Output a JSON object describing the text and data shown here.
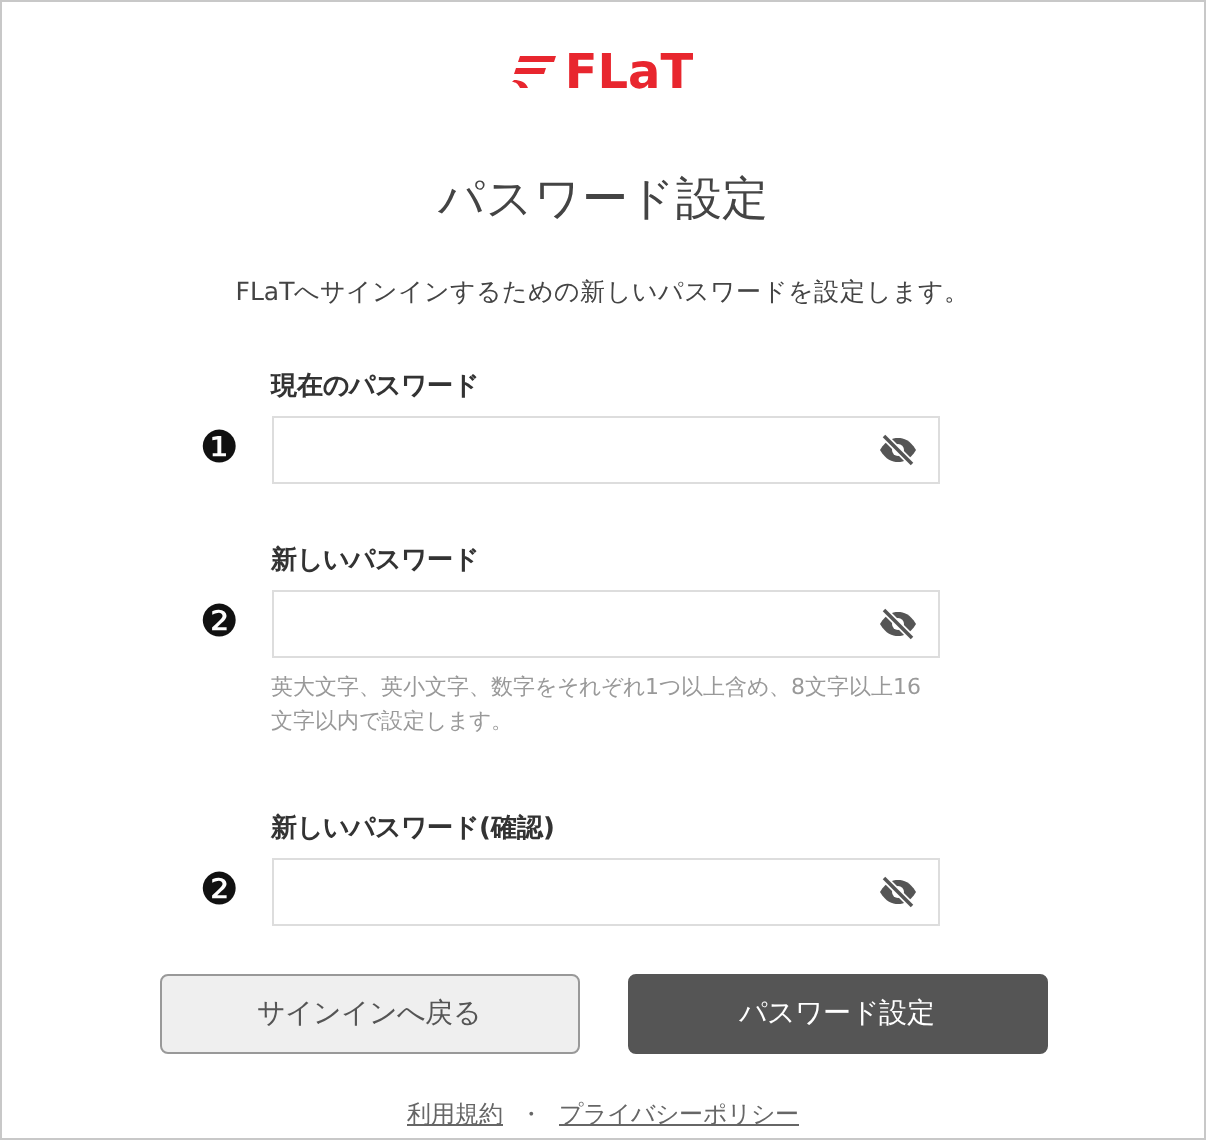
{
  "logo": {
    "text": "FLaT"
  },
  "title": "パスワード設定",
  "description": "FLaTへサインインするための新しいパスワードを設定します。",
  "fields": [
    {
      "marker": "❶",
      "label": "現在のパスワード"
    },
    {
      "marker": "❷",
      "label": "新しいパスワード",
      "hint": "英大文字、英小文字、数字をそれぞれ1つ以上含め、8文字以上16文字以内で設定します。"
    },
    {
      "marker": "❷",
      "label": "新しいパスワード(確認)"
    }
  ],
  "buttons": [
    {
      "label": "サインインへ戻る",
      "kind": "secondary"
    },
    {
      "label": "パスワード設定",
      "kind": "primary"
    }
  ],
  "footer": {
    "links": [
      "利用規約",
      "プライバシーポリシー"
    ],
    "separator": "・"
  }
}
